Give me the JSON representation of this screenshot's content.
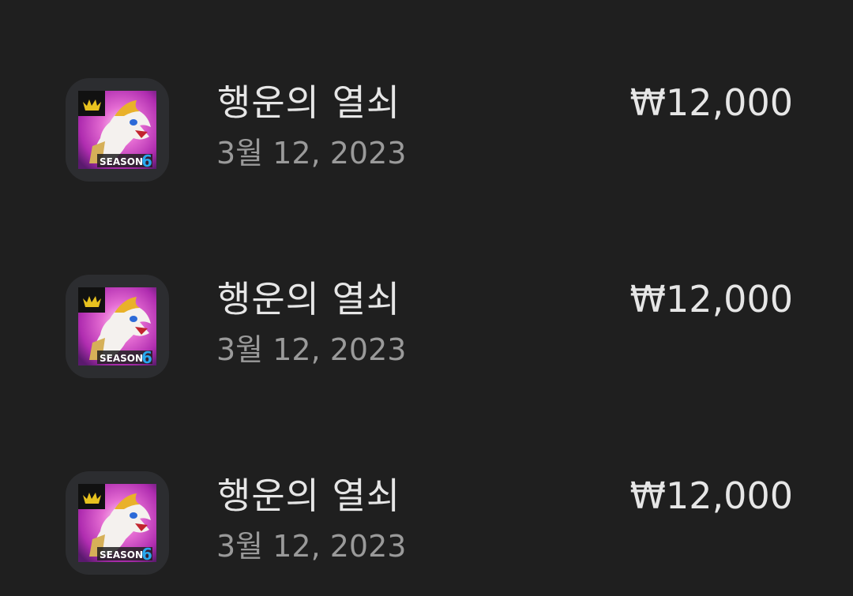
{
  "purchases": [
    {
      "app_icon": "game-app-icon",
      "badge_text": "SEASON",
      "badge_number": "6",
      "title": "행운의 열쇠",
      "date": "3월 12, 2023",
      "price": "₩12,000"
    },
    {
      "app_icon": "game-app-icon",
      "badge_text": "SEASON",
      "badge_number": "6",
      "title": "행운의 열쇠",
      "date": "3월 12, 2023",
      "price": "₩12,000"
    },
    {
      "app_icon": "game-app-icon",
      "badge_text": "SEASON",
      "badge_number": "6",
      "title": "행운의 열쇠",
      "date": "3월 12, 2023",
      "price": "₩12,000"
    }
  ],
  "colors": {
    "background": "#1f1f1f",
    "tile": "#2c2d30",
    "title_text": "#e6e6e6",
    "date_text": "#9a9a9a"
  }
}
